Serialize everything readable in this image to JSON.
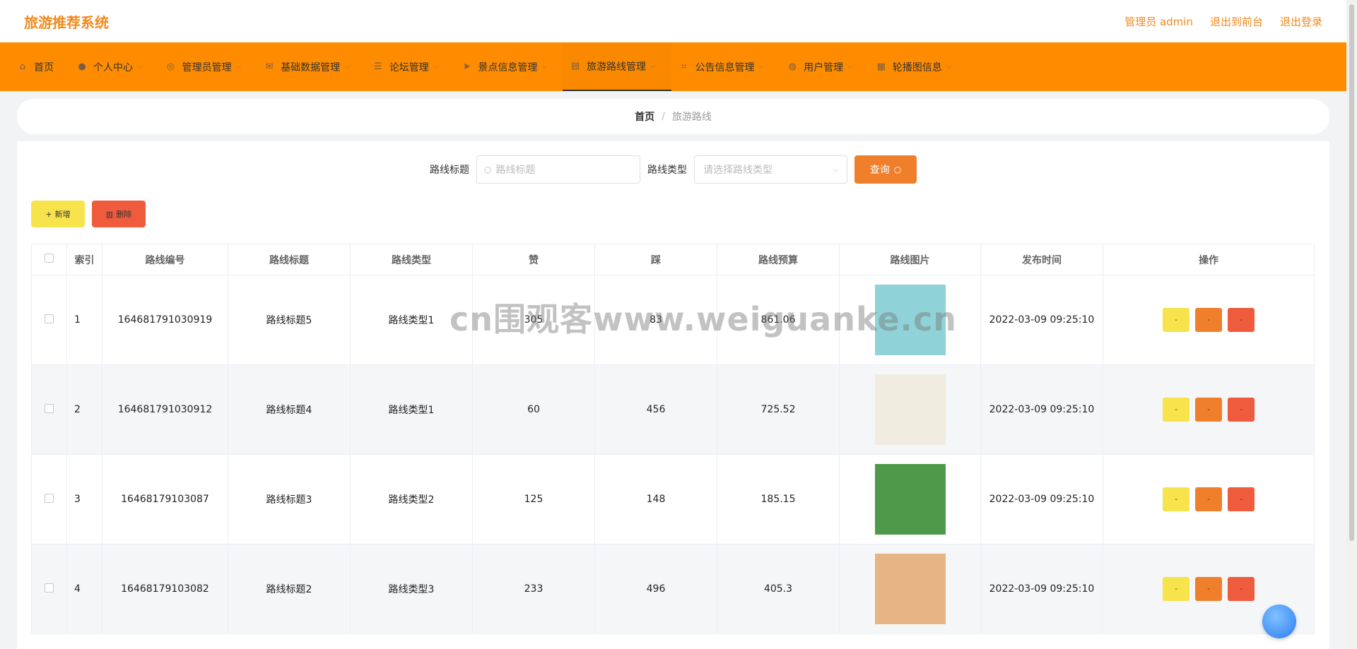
{
  "header": {
    "brand": "旅游推荐系统",
    "links": [
      "管理员 admin",
      "退出到前台",
      "退出登录"
    ]
  },
  "nav": {
    "items": [
      {
        "label": "首页",
        "icon": "home-icon",
        "glyph": "⌂",
        "caret": false
      },
      {
        "label": "个人中心",
        "icon": "user-icon",
        "glyph": "●",
        "caret": true
      },
      {
        "label": "管理员管理",
        "icon": "compass-icon",
        "glyph": "◎",
        "caret": true
      },
      {
        "label": "基础数据管理",
        "icon": "mail-icon",
        "glyph": "✉",
        "caret": true
      },
      {
        "label": "论坛管理",
        "icon": "list-icon",
        "glyph": "☰",
        "caret": true
      },
      {
        "label": "景点信息管理",
        "icon": "send-icon",
        "glyph": "➤",
        "caret": true
      },
      {
        "label": "旅游路线管理",
        "icon": "clipboard-icon",
        "glyph": "▤",
        "caret": true
      },
      {
        "label": "公告信息管理",
        "icon": "crop-icon",
        "glyph": "⌗",
        "caret": true
      },
      {
        "label": "用户管理",
        "icon": "globe-icon",
        "glyph": "◍",
        "caret": true
      },
      {
        "label": "轮播图信息",
        "icon": "grid-icon",
        "glyph": "▦",
        "caret": true
      }
    ],
    "active_index": 6
  },
  "breadcrumb": {
    "home": "首页",
    "current": "旅游路线"
  },
  "search": {
    "title_label": "路线标题",
    "title_placeholder": "路线标题",
    "type_label": "路线类型",
    "type_placeholder": "请选择路线类型",
    "query_label": "查询"
  },
  "actions": {
    "add_label": "新增",
    "delete_label": "删除"
  },
  "table": {
    "headers": [
      "索引",
      "路线编号",
      "路线标题",
      "路线类型",
      "赞",
      "踩",
      "路线预算",
      "路线图片",
      "发布时间",
      "操作"
    ],
    "rows": [
      {
        "index": "1",
        "code": "164681791030919",
        "title": "路线标题5",
        "type": "路线类型1",
        "like": "305",
        "dislike": "83",
        "budget": "861.06",
        "time": "2022-03-09 09:25:10",
        "img": "#8fd3d8"
      },
      {
        "index": "2",
        "code": "164681791030912",
        "title": "路线标题4",
        "type": "路线类型1",
        "like": "60",
        "dislike": "456",
        "budget": "725.52",
        "time": "2022-03-09 09:25:10",
        "img": "#f1ece0"
      },
      {
        "index": "3",
        "code": "16468179103087",
        "title": "路线标题3",
        "type": "路线类型2",
        "like": "125",
        "dislike": "148",
        "budget": "185.15",
        "time": "2022-03-09 09:25:10",
        "img": "#4f9a4a"
      },
      {
        "index": "4",
        "code": "16468179103082",
        "title": "路线标题2",
        "type": "路线类型3",
        "like": "233",
        "dislike": "496",
        "budget": "405.3",
        "time": "2022-03-09 09:25:10",
        "img": "#e7b585"
      }
    ],
    "op_label": "-"
  },
  "watermark": "cn围观客www.weiguanke.cn",
  "colors": {
    "brand": "#f08a1e",
    "nav": "#ff8c00",
    "yellow": "#f7e34b",
    "orange": "#f07f2c",
    "red": "#ef5b3d"
  }
}
